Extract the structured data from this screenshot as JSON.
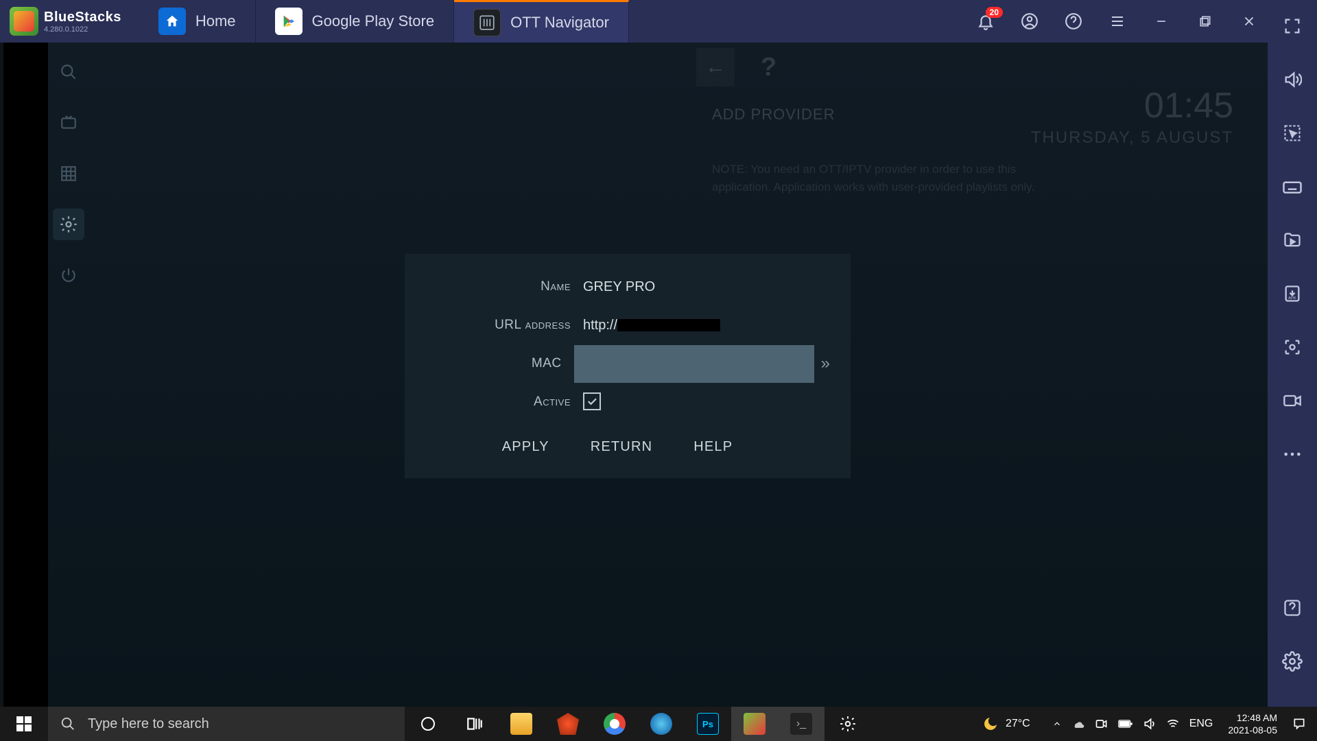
{
  "bluestacks": {
    "name": "BlueStacks",
    "version": "4.280.0.1022",
    "tabs": [
      {
        "label": "Home",
        "icon": "home"
      },
      {
        "label": "Google Play Store",
        "icon": "play"
      },
      {
        "label": "OTT Navigator",
        "icon": "ott",
        "active": true
      }
    ],
    "notification_count": "20",
    "sidebar_icons": [
      "fullscreen",
      "volume",
      "cursor",
      "keyboard",
      "media-folder",
      "install-apk",
      "screenshot",
      "record",
      "more",
      "help",
      "settings",
      "back"
    ]
  },
  "ott": {
    "side_icons": [
      "search",
      "tv",
      "grid",
      "gear",
      "power"
    ],
    "dim": {
      "heading": "ADD PROVIDER",
      "time": "01:45",
      "date": "THURSDAY, 5 AUGUST",
      "note": "NOTE: You need an OTT/IPTV provider in order to use this application. Application works with user-provided playlists only."
    },
    "modal": {
      "name_label": "Name",
      "name_value": "GREY PRO",
      "url_label": "URL address",
      "url_value": "http://",
      "mac_label": "MAC",
      "active_label": "Active",
      "active_checked": true,
      "buttons": {
        "apply": "APPLY",
        "return": "RETURN",
        "help": "HELP"
      }
    }
  },
  "taskbar": {
    "search_placeholder": "Type here to search",
    "weather_temp": "27°C",
    "lang": "ENG",
    "time": "12:48 AM",
    "date": "2021-08-05"
  }
}
